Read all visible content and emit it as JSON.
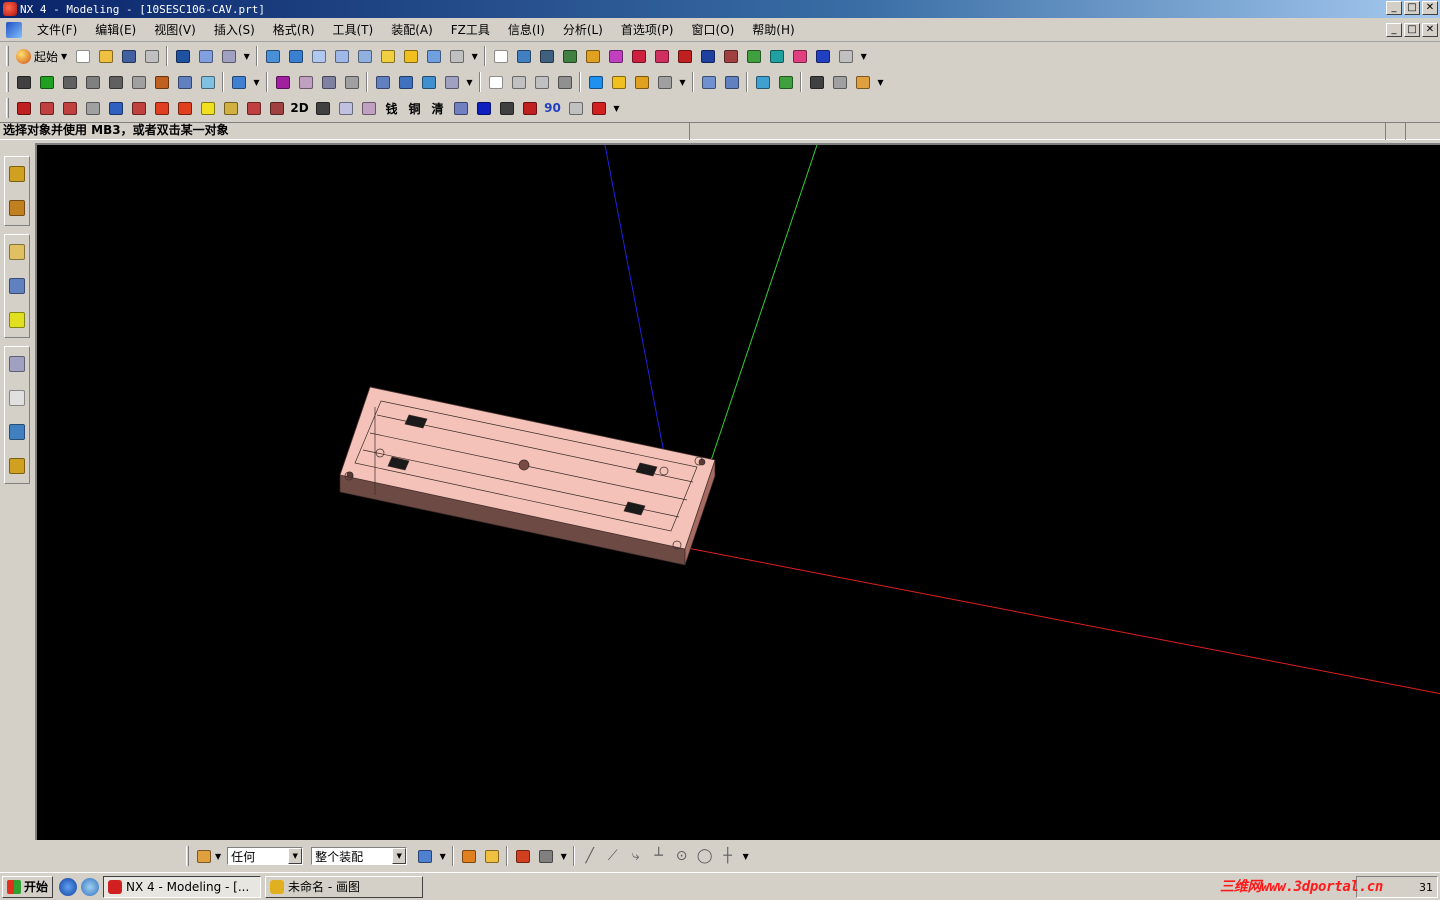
{
  "window": {
    "title": "NX 4 - Modeling - [10SESC106-CAV.prt]",
    "min": "_",
    "max": "□",
    "close": "✕"
  },
  "menu": {
    "items": [
      {
        "label": "文件(F)"
      },
      {
        "label": "编辑(E)"
      },
      {
        "label": "视图(V)"
      },
      {
        "label": "插入(S)"
      },
      {
        "label": "格式(R)"
      },
      {
        "label": "工具(T)"
      },
      {
        "label": "装配(A)"
      },
      {
        "label": "FZ工具"
      },
      {
        "label": "信息(I)"
      },
      {
        "label": "分析(L)"
      },
      {
        "label": "首选项(P)"
      },
      {
        "label": "窗口(O)"
      },
      {
        "label": "帮助(H)"
      }
    ]
  },
  "toolbar": {
    "start_label": "起始",
    "row1_icons": [
      {
        "name": "new-icon",
        "color": "#ffffff"
      },
      {
        "name": "open-icon",
        "color": "#f0c040"
      },
      {
        "name": "save-icon",
        "color": "#4060a0"
      },
      {
        "name": "print-icon",
        "color": "#c0c0c0"
      },
      {
        "name": "undo-icon",
        "color": "#2050a0"
      },
      {
        "name": "hyperlink-icon",
        "color": "#80a0e0"
      },
      {
        "name": "select-icon",
        "color": "#a0a0c0"
      },
      {
        "name": "shaded-icon",
        "color": "#4a90d9"
      },
      {
        "name": "shaded-edges-icon",
        "color": "#3a7fd0"
      },
      {
        "name": "wireframe-icon",
        "color": "#b0c8f0"
      },
      {
        "name": "hidden-edges-icon",
        "color": "#9fb8e8"
      },
      {
        "name": "static-wireframe-icon",
        "color": "#90b0e0"
      },
      {
        "name": "face-analysis-icon",
        "color": "#f0d040"
      },
      {
        "name": "studio-icon",
        "color": "#f0c020"
      },
      {
        "name": "partial-shading-icon",
        "color": "#70a0e0"
      },
      {
        "name": "translucency-icon",
        "color": "#c0c0c0"
      },
      {
        "name": "view-section-icon",
        "color": "#ffffff"
      },
      {
        "name": "layer-icon",
        "color": "#4080c0"
      },
      {
        "name": "move-layer-icon",
        "color": "#406080"
      },
      {
        "name": "copy-layer-icon",
        "color": "#408040"
      },
      {
        "name": "wcs-icon",
        "color": "#e0a020"
      },
      {
        "name": "view-orient-icon",
        "color": "#c040c0"
      },
      {
        "name": "analysis-a-icon",
        "color": "#d02040"
      },
      {
        "name": "analysis-b-icon",
        "color": "#d03060"
      },
      {
        "name": "analysis-c-icon",
        "color": "#c02020"
      },
      {
        "name": "info-icon",
        "color": "#2040a0"
      },
      {
        "name": "measure-icon",
        "color": "#a04040"
      },
      {
        "name": "draft-icon",
        "color": "#40a040"
      },
      {
        "name": "color-icon",
        "color": "#20a0a0"
      },
      {
        "name": "gear-icon",
        "color": "#e04080"
      },
      {
        "name": "calc-icon",
        "color": "#2040c0"
      },
      {
        "name": "text-icon",
        "color": "#c0c0c0"
      }
    ],
    "row2_icons": [
      {
        "name": "mold-wizard-icon",
        "color": "#404040"
      },
      {
        "name": "mold-init-icon",
        "color": "#20a020"
      },
      {
        "name": "mold-csys-icon",
        "color": "#606060"
      },
      {
        "name": "shrinkage-icon",
        "color": "#808080"
      },
      {
        "name": "workpiece-icon",
        "color": "#606060"
      },
      {
        "name": "layout-icon",
        "color": "#a0a0a0"
      },
      {
        "name": "family-mold-icon",
        "color": "#c06020"
      },
      {
        "name": "mold-tool-icon",
        "color": "#6080c0"
      },
      {
        "name": "parting-icon",
        "color": "#80c0e0"
      },
      {
        "name": "mold-base-icon",
        "color": "#4080d0"
      },
      {
        "name": "standard-part-icon",
        "color": "#a020a0"
      },
      {
        "name": "ejector-icon",
        "color": "#c0a0c0"
      },
      {
        "name": "slider-icon",
        "color": "#8080a0"
      },
      {
        "name": "subinsert-icon",
        "color": "#a0a0a0"
      },
      {
        "name": "gate-icon",
        "color": "#6080c0"
      },
      {
        "name": "runner-icon",
        "color": "#4070c0"
      },
      {
        "name": "cooling-icon",
        "color": "#4090d0"
      },
      {
        "name": "electrode-icon",
        "color": "#a0a0c0"
      },
      {
        "name": "trim-icon",
        "color": "#ffffff"
      },
      {
        "name": "cavity-icon",
        "color": "#c0c0c0"
      },
      {
        "name": "bom-icon",
        "color": "#c0c0c0"
      },
      {
        "name": "drawing-icon",
        "color": "#909090"
      },
      {
        "name": "arrow-left-icon",
        "color": "#2090f0"
      },
      {
        "name": "arrow-right-icon",
        "color": "#f0c020"
      },
      {
        "name": "view-mgr-icon",
        "color": "#e0a020"
      },
      {
        "name": "list-icon",
        "color": "#a0a0a0"
      },
      {
        "name": "clamp-icon",
        "color": "#7090d0"
      },
      {
        "name": "pocket-icon",
        "color": "#6080c0"
      },
      {
        "name": "forward-icon",
        "color": "#40a0d0"
      },
      {
        "name": "next-icon",
        "color": "#40a040"
      },
      {
        "name": "measure2-icon",
        "color": "#404040"
      },
      {
        "name": "misc-icon",
        "color": "#a0a0a0"
      },
      {
        "name": "cat-icon",
        "color": "#e0a040"
      }
    ],
    "row3_icons": [
      {
        "name": "block-icon",
        "color": "#c02020"
      },
      {
        "name": "box-icon",
        "color": "#c04040"
      },
      {
        "name": "cylinder-icon",
        "color": "#c04040"
      },
      {
        "name": "pin-icon",
        "color": "#a0a0a0"
      },
      {
        "name": "hole-icon",
        "color": "#3060c0"
      },
      {
        "name": "dimension-icon",
        "color": "#c04040"
      },
      {
        "name": "target-icon",
        "color": "#e04020"
      },
      {
        "name": "target2-icon",
        "color": "#e04020"
      },
      {
        "name": "yellow-icon",
        "color": "#f0e020"
      },
      {
        "name": "stack-icon",
        "color": "#d0b040"
      },
      {
        "name": "thread-icon",
        "color": "#c04040"
      },
      {
        "name": "trim2-icon",
        "color": "#a04040"
      },
      {
        "name": "text-2d",
        "color": "#000000"
      },
      {
        "name": "dim2-icon",
        "color": "#404040"
      },
      {
        "name": "plate-icon",
        "color": "#c0c0e0"
      },
      {
        "name": "faded-icon",
        "color": "#c0a0c0"
      },
      {
        "name": "char-a-icon",
        "color": "#404040"
      },
      {
        "name": "char-b-icon",
        "color": "#404040"
      },
      {
        "name": "char-c-icon",
        "color": "#404040"
      },
      {
        "name": "label-icon",
        "color": "#7080c0"
      },
      {
        "name": "blue-box-icon",
        "color": "#1020c0"
      },
      {
        "name": "dark-icon",
        "color": "#404040"
      },
      {
        "name": "bomb-icon",
        "color": "#c02020"
      },
      {
        "name": "rotate-icon",
        "color": "#2040c0"
      },
      {
        "name": "faded2-icon",
        "color": "#c0c0c0"
      },
      {
        "name": "red-ball-icon",
        "color": "#d02020"
      }
    ],
    "text_2d": "2D",
    "char_a": "钱",
    "char_b": "铜",
    "char_c": "清",
    "rotate_label": "90"
  },
  "cue": {
    "prompt": "选择对象并使用 MB3，或者双击某一对象"
  },
  "resource_bar": {
    "groups": [
      [
        {
          "name": "assembly-navigator-icon",
          "color": "#d0a020"
        },
        {
          "name": "part-navigator-icon",
          "color": "#c08020"
        }
      ],
      [
        {
          "name": "reuse-library-icon",
          "color": "#e0c060"
        },
        {
          "name": "web-browser-icon",
          "color": "#6080c0"
        },
        {
          "name": "help-icon",
          "color": "#e0e020"
        }
      ],
      [
        {
          "name": "history-icon",
          "color": "#a0a0c0"
        },
        {
          "name": "system-materials-icon",
          "color": "#e0e0e0"
        },
        {
          "name": "process-studio-icon",
          "color": "#4080c0"
        },
        {
          "name": "roles-icon",
          "color": "#d0a020"
        }
      ]
    ]
  },
  "selection_bar": {
    "filter_value": "任何",
    "scope_value": "整个装配"
  },
  "taskbar": {
    "start_label": "开始",
    "tasks": [
      {
        "label": "NX 4 - Modeling - [...",
        "active": true,
        "color": "#d02020"
      },
      {
        "label": "未命名 - 画图",
        "active": false,
        "color": "#e0b020"
      }
    ],
    "clock": "31"
  },
  "watermark": "三维网www.3dportal.cn",
  "viewport": {
    "background": "#000000",
    "part_color": "#f4c2b8",
    "axis_x_color": "#e02020",
    "axis_y_color": "#30d030",
    "axis_z_color": "#2020e0"
  }
}
